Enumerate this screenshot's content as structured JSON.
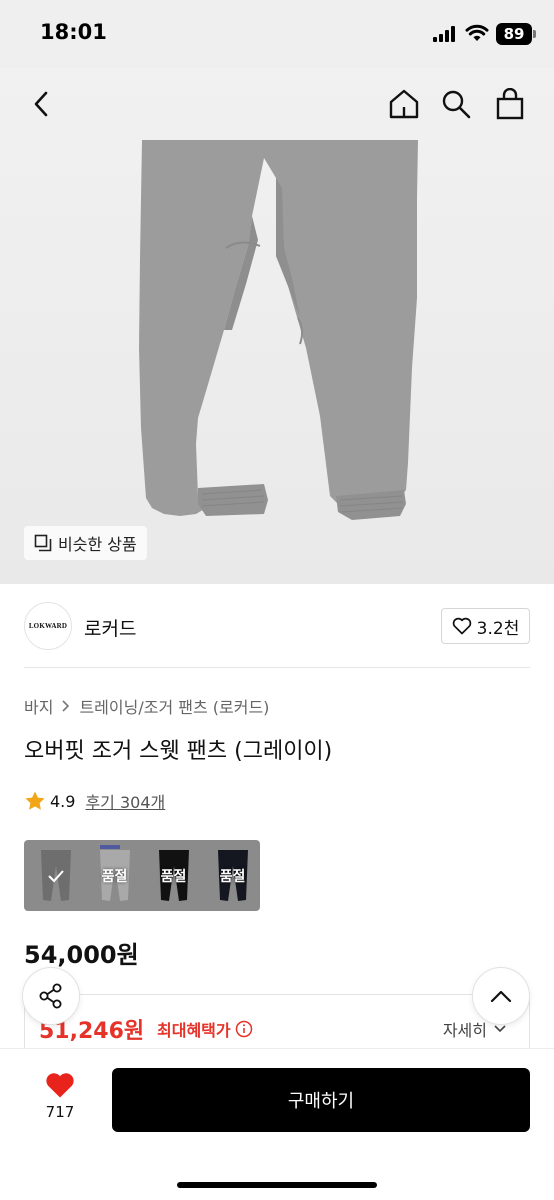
{
  "status_bar": {
    "time": "18:01",
    "battery": "89"
  },
  "nav": {
    "icons": [
      "back-icon",
      "home-icon",
      "search-icon",
      "shopping-bag-icon"
    ]
  },
  "hero": {
    "similar_label": "비슷한 상품"
  },
  "brand": {
    "logo_text": "LOKWARD",
    "name": "로커드",
    "likes": "3.2천"
  },
  "breadcrumb": {
    "items": [
      "바지",
      "트레이닝/조거 팬츠 (로커드)"
    ]
  },
  "product": {
    "title": "오버핏 조거 스웻 팬츠 (그레이이)",
    "rating": "4.9",
    "review_text": "후기 304개",
    "price": "54,000원"
  },
  "swatches": [
    {
      "color": "#6e6e6e",
      "label": "",
      "selected": true
    },
    {
      "color": "#a9a9a9",
      "label": "품절",
      "selected": false
    },
    {
      "color": "#111111",
      "label": "품절",
      "selected": false
    },
    {
      "color": "#151720",
      "label": "품절",
      "selected": false
    }
  ],
  "benefit": {
    "price": "51,246원",
    "label": "최대혜택가",
    "detail_label": "자세히"
  },
  "bottom": {
    "wish_count": "717",
    "buy_label": "구매하기"
  },
  "colors": {
    "accent_red": "#e5332a",
    "buy_button": "#000000",
    "heart": "#e8231b"
  }
}
